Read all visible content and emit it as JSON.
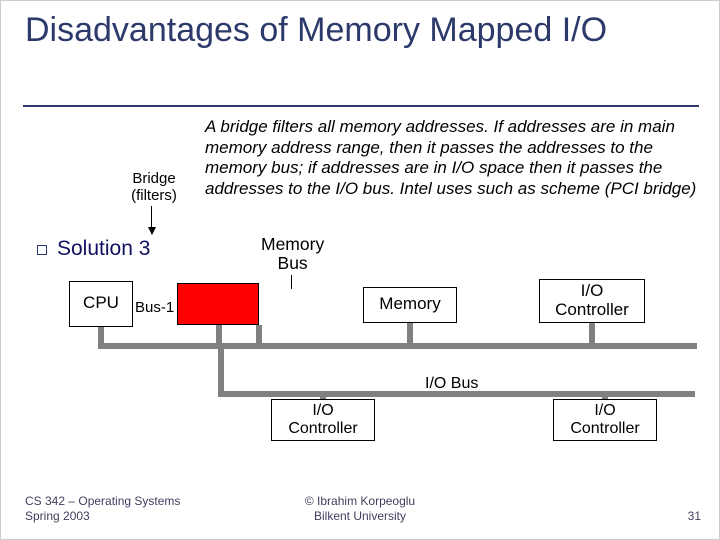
{
  "title": "Disadvantages of Memory Mapped I/O",
  "bridge_label_l1": "Bridge",
  "bridge_label_l2": "(filters)",
  "description": "A bridge filters all memory addresses. If addresses are in main memory address range, then it passes the addresses to the memory bus; if addresses are in I/O space then it passes the addresses to the I/O bus.  Intel uses such as scheme (PCI bridge)",
  "solution_label": "Solution 3",
  "memory_bus_l1": "Memory",
  "memory_bus_l2": "Bus",
  "cpu_label": "CPU",
  "bus1_label": "Bus-1",
  "memory_label": "Memory",
  "io_controller_l1": "I/O",
  "io_controller_l2": "Controller",
  "io_bus_label": "I/O Bus",
  "footer_course_l1": "CS 342 – Operating Systems",
  "footer_course_l2": "Spring 2003",
  "footer_copy_l1": "© Ibrahim Korpeoglu",
  "footer_copy_l2": "Bilkent University",
  "slide_number": "31"
}
